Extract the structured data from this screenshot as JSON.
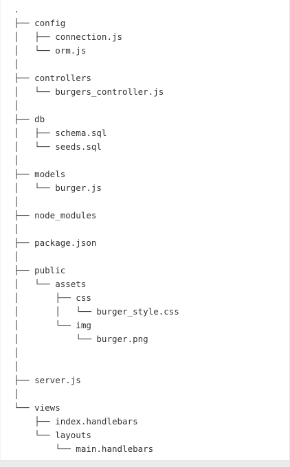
{
  "tree": {
    "lines": [
      ".",
      "├── config",
      "│   ├── connection.js",
      "│   └── orm.js",
      "│",
      "├── controllers",
      "│   └── burgers_controller.js",
      "│",
      "├── db",
      "│   ├── schema.sql",
      "│   └── seeds.sql",
      "│",
      "├── models",
      "│   └── burger.js",
      "│",
      "├── node_modules",
      "│",
      "├── package.json",
      "│",
      "├── public",
      "│   └── assets",
      "│       ├── css",
      "│       │   └── burger_style.css",
      "│       └── img",
      "│           └── burger.png",
      "│",
      "│",
      "├── server.js",
      "│",
      "└── views",
      "    ├── index.handlebars",
      "    └── layouts",
      "        └── main.handlebars"
    ]
  }
}
